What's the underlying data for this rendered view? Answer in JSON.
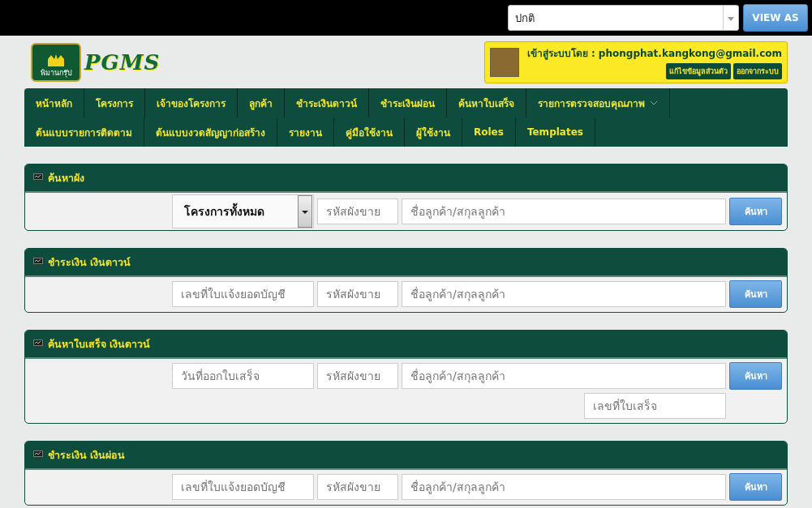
{
  "top_bar": {
    "role_select": {
      "value": "ปกติ"
    },
    "view_as_button": "VIEW AS"
  },
  "header": {
    "logo": {
      "badge_text": "พิมานกรุ๊ป",
      "text": "PGMS"
    },
    "user": {
      "login_text": "เข้าสู่ระบบโดย : phongphat.kangkong@gmail.com",
      "buttons": [
        "แก้ไขข้อมูลส่วนตัว",
        "ออกจากระบบ"
      ]
    }
  },
  "nav": {
    "items": [
      {
        "label": "หน้าหลัก",
        "has_dropdown": false
      },
      {
        "label": "โครงการ",
        "has_dropdown": false
      },
      {
        "label": "เจ้าของโครงการ",
        "has_dropdown": false
      },
      {
        "label": "ลูกค้า",
        "has_dropdown": false
      },
      {
        "label": "ชำระเงินดาวน์",
        "has_dropdown": false
      },
      {
        "label": "ชำระเงินผ่อน",
        "has_dropdown": false
      },
      {
        "label": "ค้นหาใบเสร็จ",
        "has_dropdown": false
      },
      {
        "label": "รายการตรวจสอบคุณภาพ",
        "has_dropdown": true
      },
      {
        "label": "ต้นแบบรายการติดตาม",
        "has_dropdown": false
      },
      {
        "label": "ต้นแบบงวดสัญญาก่อสร้าง",
        "has_dropdown": false
      },
      {
        "label": "รายงาน",
        "has_dropdown": false
      },
      {
        "label": "คู่มือใช้งาน",
        "has_dropdown": false
      },
      {
        "label": "ผู้ใช้งาน",
        "has_dropdown": false
      },
      {
        "label": "Roles",
        "has_dropdown": false
      },
      {
        "label": "Templates",
        "has_dropdown": false
      }
    ]
  },
  "panels": [
    {
      "title": "ค้นหาผัง",
      "fields": [
        {
          "kind": "select",
          "value": "โครงการทั้งหมด"
        },
        {
          "kind": "input",
          "placeholder": "รหัสผังขาย"
        },
        {
          "kind": "input",
          "placeholder": "ชื่อลูกค้า/สกุลลูกค้า"
        }
      ],
      "button": "ค้นหา"
    },
    {
      "title": "ชำระเงิน เงินดาวน์",
      "fields": [
        {
          "kind": "input",
          "placeholder": "เลขที่ใบแจ้งยอดบัญชี"
        },
        {
          "kind": "input",
          "placeholder": "รหัสผังขาย"
        },
        {
          "kind": "input",
          "placeholder": "ชื่อลูกค้า/สกุลลูกค้า"
        }
      ],
      "button": "ค้นหา"
    },
    {
      "title": "ค้นหาใบเสร็จ เงินดาวน์",
      "fields": [
        {
          "kind": "input",
          "placeholder": "วันที่ออกใบเสร็จ"
        },
        {
          "kind": "input",
          "placeholder": "รหัสผังขาย"
        },
        {
          "kind": "input",
          "placeholder": "ชื่อลูกค้า/สกุลลูกค้า"
        }
      ],
      "second_row_fields": [
        {
          "kind": "input",
          "placeholder": "เลขที่ใบเสร็จ"
        }
      ],
      "button": "ค้นหา"
    },
    {
      "title": "ชำระเงิน เงินผ่อน",
      "fields": [
        {
          "kind": "input",
          "placeholder": "เลขที่ใบแจ้งยอดบัญชี"
        },
        {
          "kind": "input",
          "placeholder": "รหัสผังขาย"
        },
        {
          "kind": "input",
          "placeholder": "ชื่อลูกค้า/สกุลลูกค้า"
        }
      ],
      "button": "ค้นหา"
    }
  ]
}
